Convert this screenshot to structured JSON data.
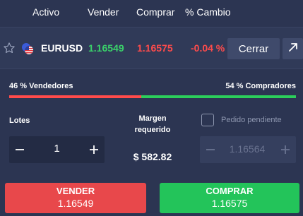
{
  "header": {
    "col_asset": "Activo",
    "col_sell": "Vender",
    "col_buy": "Comprar",
    "col_change": "% Cambio"
  },
  "position": {
    "symbol": "EURUSD",
    "sell_price": "1.16549",
    "buy_price": "1.16575",
    "change": "-0.04 %",
    "close_label": "Cerrar"
  },
  "sentiment": {
    "sellers_label": "46 % Vendedores",
    "buyers_label": "54 % Compradores",
    "sellers_fraction": 0.46
  },
  "order": {
    "lots_label": "Lotes",
    "lots_value": "1",
    "margin_label": "Margen requerido",
    "margin_value": "$ 582.82",
    "pending_label": "Pedido pendiente",
    "pending_value": "1.16564",
    "pending_checked": false
  },
  "actions": {
    "sell_label": "VENDER",
    "sell_price": "1.16549",
    "buy_label": "COMPRAR",
    "buy_price": "1.16575"
  },
  "colors": {
    "background": "#2c3552",
    "sell": "#e8484b",
    "buy": "#23c45a",
    "positive_text": "#3ad16a",
    "negative_text": "#ff4b4b"
  }
}
